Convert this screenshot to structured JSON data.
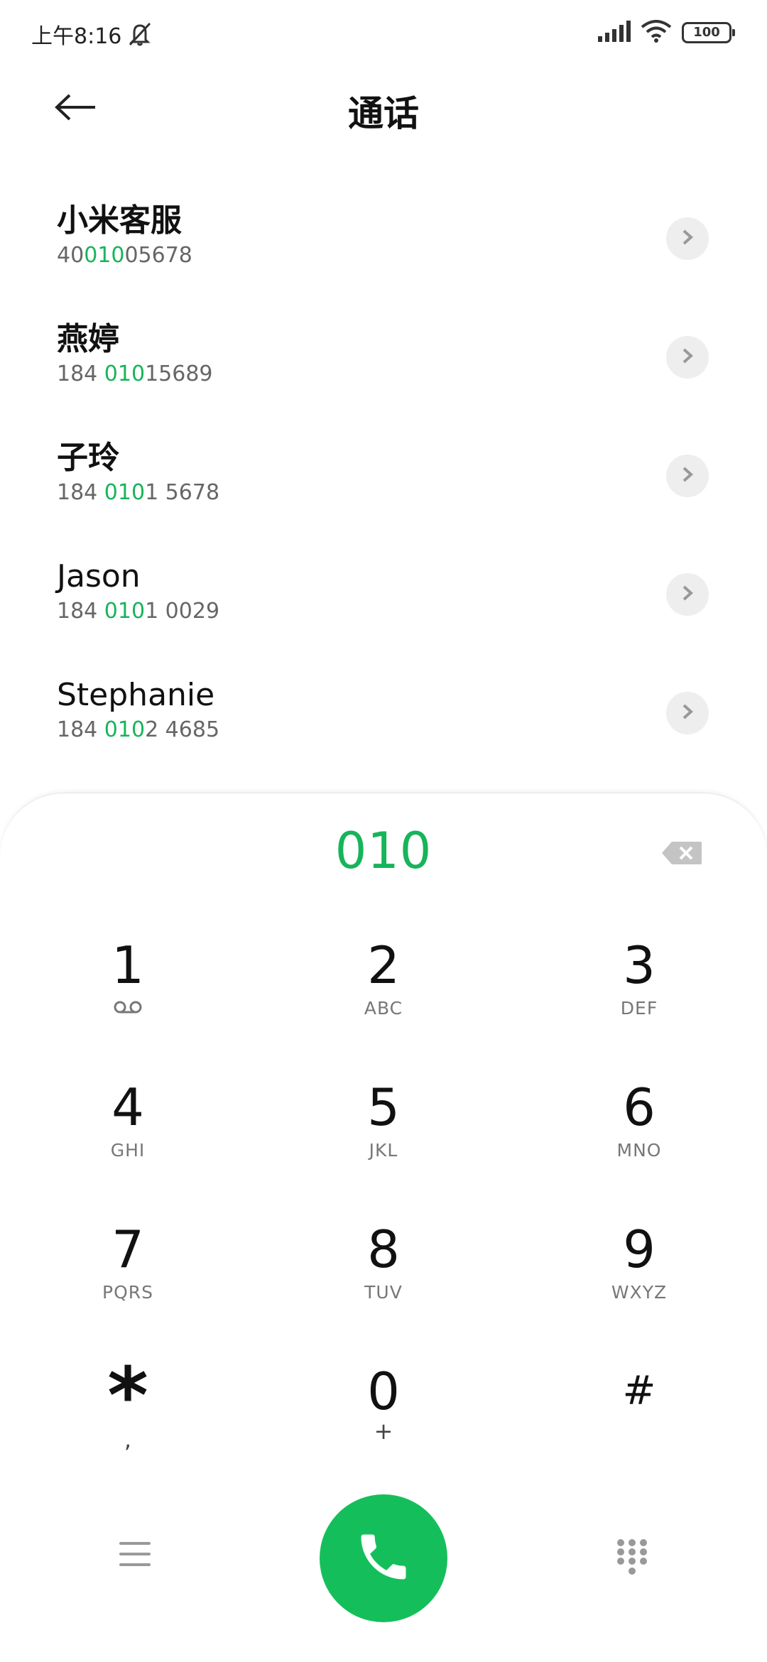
{
  "status_bar": {
    "time": "上午8:16",
    "battery": "100",
    "icons": [
      "mute-icon",
      "signal-icon",
      "wifi-icon",
      "battery-icon"
    ]
  },
  "header": {
    "title": "通话",
    "back_icon": "arrow-left-icon"
  },
  "contacts": [
    {
      "name": "小米客服",
      "number_pre": "40",
      "number_match": "010",
      "number_post": "05678"
    },
    {
      "name": "燕婷",
      "number_pre": "184 ",
      "number_match": "010",
      "number_post": "15689"
    },
    {
      "name": "子玲",
      "number_pre": "184 ",
      "number_match": "010",
      "number_post": "1 5678"
    },
    {
      "name": "Jason",
      "number_pre": "184 ",
      "number_match": "010",
      "number_post": "1 0029"
    },
    {
      "name": "Stephanie",
      "number_pre": "184 ",
      "number_match": "010",
      "number_post": "2 4685"
    }
  ],
  "dialer": {
    "input": "010",
    "accent_color": "#17b45a",
    "keys": [
      {
        "digit": "1",
        "letters": ""
      },
      {
        "digit": "2",
        "letters": "ABC"
      },
      {
        "digit": "3",
        "letters": "DEF"
      },
      {
        "digit": "4",
        "letters": "GHI"
      },
      {
        "digit": "5",
        "letters": "JKL"
      },
      {
        "digit": "6",
        "letters": "MNO"
      },
      {
        "digit": "7",
        "letters": "PQRS"
      },
      {
        "digit": "8",
        "letters": "TUV"
      },
      {
        "digit": "9",
        "letters": "WXYZ"
      },
      {
        "digit": "*",
        "letters": ","
      },
      {
        "digit": "0",
        "letters": "+"
      },
      {
        "digit": "#",
        "letters": ""
      }
    ],
    "bottom_icons": [
      "menu-icon",
      "phone-icon",
      "dialpad-icon"
    ]
  }
}
